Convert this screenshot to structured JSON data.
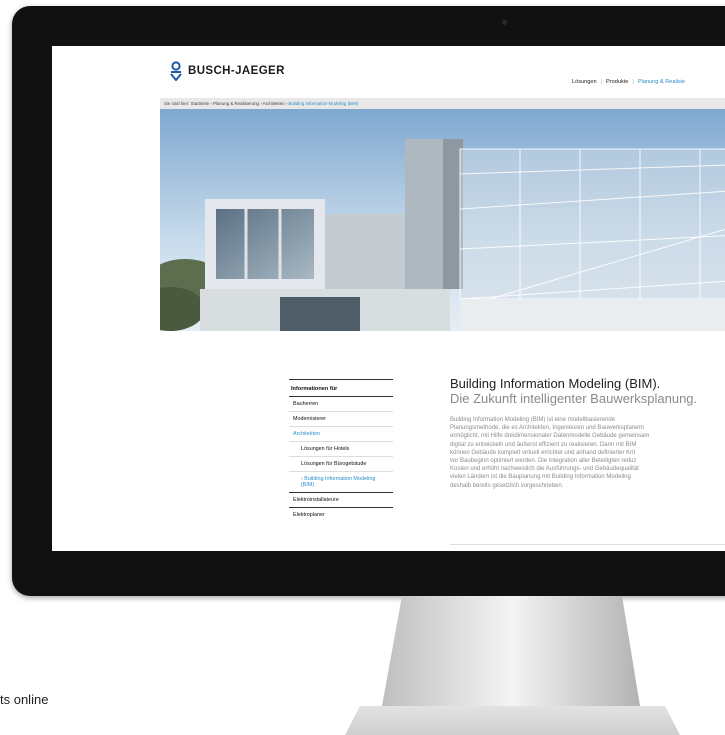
{
  "site": {
    "brand": "BUSCH-JAEGER",
    "nav": [
      "Lösungen",
      "Produkte",
      "Planung & Realisie"
    ],
    "nav_active_index": 2
  },
  "breadcrumb": {
    "prefix": "Sie sind hier:",
    "items": [
      "Startseite",
      "Planung & Realisierung",
      "Architekten"
    ],
    "current": "Building Information Modeling (BIM)"
  },
  "sidebar": {
    "title": "Informationen für",
    "items": [
      {
        "label": "Bauherren"
      },
      {
        "label": "Modernisierer"
      },
      {
        "label": "Architekten",
        "active": true
      },
      {
        "label": "Lösungen für Hotels",
        "sub": true
      },
      {
        "label": "Lösungen für Bürogebäude",
        "sub": true
      },
      {
        "label": "› Building Information Modeling (BIM)",
        "sub": true,
        "active": true
      },
      {
        "label": "Elektroinstallateure"
      },
      {
        "label": "Elektroplaner"
      }
    ]
  },
  "content": {
    "title": "Building Information Modeling (BIM).",
    "subtitle": "Die Zukunft intelligenter Bauwerksplanung.",
    "body_lines": [
      "Building Information Modeling (BIM) ist eine modellbasierende",
      "Planungsmethode, die es Architekten, Ingenieuren und Bauwerksplanern",
      "ermöglicht, mit Hilfe dreidimensionaler Datenmodelle Gebäude gemeinsam",
      "digital zu entwickeln und äußerst effizient zu realisieren. Dann mit BIM",
      "können Gebäude komplett virtuell errichtet und anhand definierter Krit",
      "vor Baubeginn optimiert werden. Die Integration aller Beteiligten reduz",
      "Kosten und erhöht nachweislich die Ausführungs- und Gebäudequalität",
      "vielen Ländern ist die Bauplanung mit Building Information Modeling",
      "deshalb bereits gesetzlich vorgeschrieben."
    ]
  },
  "caption": "ts online"
}
